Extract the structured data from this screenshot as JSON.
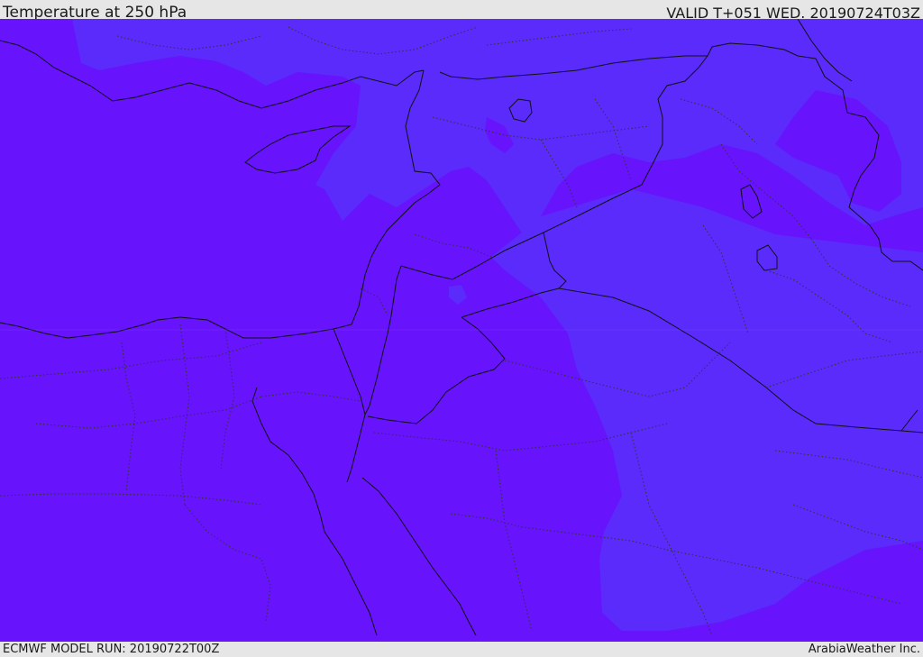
{
  "header": {
    "title": "Temperature at 250 hPa",
    "valid_time": "VALID T+051 WED. 20190724T03Z"
  },
  "footer": {
    "model_run": "ECMWF MODEL RUN: 20190722T00Z",
    "credit": "ArabiaWeather Inc."
  },
  "map": {
    "colors": {
      "field_warm": "#6713fc",
      "field_cool": "#5a2bfb",
      "border": "#111111",
      "province": "#333333"
    }
  }
}
